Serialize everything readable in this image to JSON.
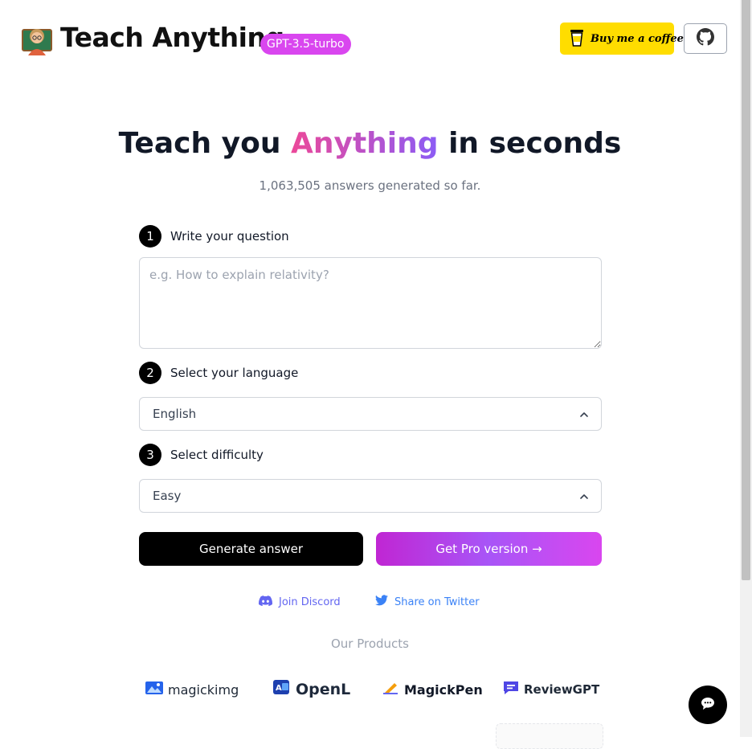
{
  "header": {
    "title": "Teach Anything",
    "model_badge": "GPT-3.5-turbo",
    "coffee_label": "Buy me a coffee",
    "logo_icon": "teacher-emoji",
    "github_icon": "github-icon"
  },
  "hero": {
    "title_prefix": "Teach you ",
    "title_highlight": "Anything",
    "title_suffix": " in seconds",
    "counter": "1,063,505 answers generated so far."
  },
  "form": {
    "step1": {
      "number": "1",
      "label": "Write your question",
      "placeholder": "e.g. How to explain relativity?"
    },
    "step2": {
      "number": "2",
      "label": "Select your language",
      "value": "English"
    },
    "step3": {
      "number": "3",
      "label": "Select difficulty",
      "value": "Easy"
    },
    "generate_label": "Generate answer",
    "pro_label": "Get Pro version →"
  },
  "links": {
    "discord": "Join Discord",
    "twitter": "Share on Twitter"
  },
  "products": {
    "title": "Our Products",
    "items": [
      {
        "name": "magickimg"
      },
      {
        "name": "OpenL"
      },
      {
        "name": "MagickPen"
      },
      {
        "name": "ReviewGPT"
      }
    ]
  },
  "colors": {
    "accent": "#d946ef",
    "coffee": "#ffdd00",
    "discord": "#6366f1",
    "twitter": "#3b82f6"
  }
}
